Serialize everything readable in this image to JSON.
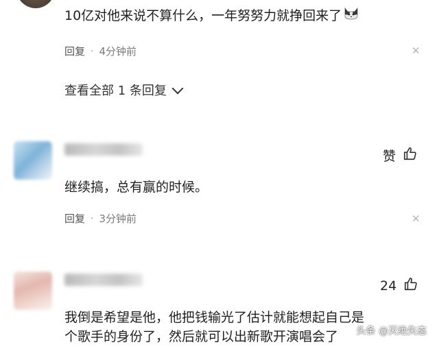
{
  "comment1": {
    "text": "10亿对他来说不算什么，一年努努力就挣回来了",
    "reply_label": "回复",
    "separator": "·",
    "time": "4分钟前",
    "view_all": "查看全部 1 条回复"
  },
  "comment2": {
    "like_label": "赞",
    "text": "继续搞，总有赢的时候。",
    "reply_label": "回复",
    "separator": "·",
    "time": "3分钟前"
  },
  "comment3": {
    "like_count": "24",
    "text_line1": "我倒是希望是他，他把钱输光了估计就能想起自己是",
    "text_line2": "个歌手的身份了，然后就可以出新歌开演唱会了"
  },
  "watermark": {
    "text": "头条 @灭绝失态"
  },
  "colors": {
    "text": "#1f1f1f",
    "meta": "#555555",
    "muted": "#9a9a9a"
  },
  "icons": [
    "cat-emoji-icon",
    "close-icon",
    "chevron-down-icon",
    "thumbs-up-icon"
  ]
}
